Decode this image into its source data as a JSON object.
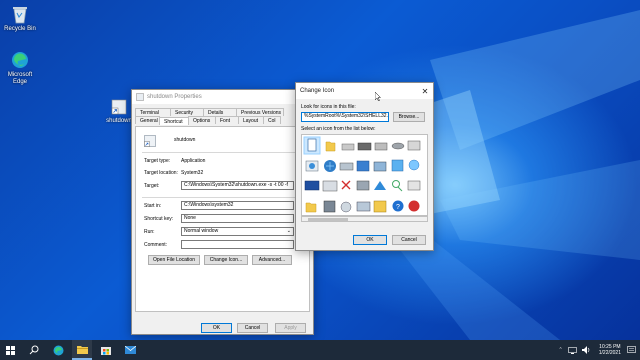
{
  "desktop": {
    "icons": [
      {
        "label": "Recycle Bin"
      },
      {
        "label": "Microsoft Edge"
      },
      {
        "label": "shutdown"
      }
    ]
  },
  "properties_dialog": {
    "title": "shutdown Properties",
    "tabs_row1": [
      "Terminal",
      "Security",
      "Details",
      "Previous Versions"
    ],
    "tabs_row2": [
      "General",
      "Shortcut",
      "Options",
      "Font",
      "Layout",
      "Col"
    ],
    "active_tab": "Shortcut",
    "shortcut_name": "shutdown",
    "target_type_label": "Target type:",
    "target_type_value": "Application",
    "target_location_label": "Target location:",
    "target_location_value": "System32",
    "target_label": "Target:",
    "target_value": "C:\\Windows\\System32\\shutdown.exe -s -t 00 -f",
    "start_in_label": "Start in:",
    "start_in_value": "C:\\Windows\\system32",
    "shortcut_key_label": "Shortcut key:",
    "shortcut_key_value": "None",
    "run_label": "Run:",
    "run_value": "Normal window",
    "comment_label": "Comment:",
    "comment_value": "",
    "buttons": {
      "open_file_location": "Open File Location",
      "change_icon": "Change Icon...",
      "advanced": "Advanced...",
      "ok": "OK",
      "cancel": "Cancel",
      "apply": "Apply"
    }
  },
  "change_icon_dialog": {
    "title": "Change Icon",
    "look_for_label": "Look for icons in this file:",
    "file_path": "%SystemRoot%\\System32\\SHELL32.dll",
    "browse": "Browse...",
    "select_label": "Select an icon from the list below:",
    "ok": "OK",
    "cancel": "Cancel"
  },
  "taskbar": {
    "time": "10:25 PM",
    "date": "1/22/2021",
    "items": [
      "start-icon",
      "search-icon",
      "edge-icon",
      "file-explorer-icon",
      "store-icon",
      "mail-icon"
    ]
  }
}
